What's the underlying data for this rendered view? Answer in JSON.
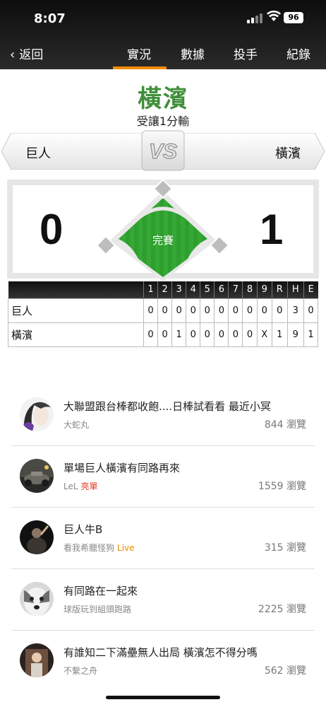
{
  "status_bar": {
    "time": "8:07",
    "battery": "96"
  },
  "nav": {
    "back_label": "返回",
    "tabs": [
      "實況",
      "數據",
      "投手",
      "紀錄"
    ],
    "active_tab": "實況"
  },
  "game": {
    "winner": "橫濱",
    "result_text": "受讓1分輸",
    "away_team": "巨人",
    "home_team": "橫濱",
    "vs_label": "VS",
    "away_score": "0",
    "home_score": "1",
    "status": "完賽"
  },
  "linescore": {
    "headers": [
      "1",
      "2",
      "3",
      "4",
      "5",
      "6",
      "7",
      "8",
      "9",
      "R",
      "H",
      "E"
    ],
    "rows": [
      {
        "team": "巨人",
        "cells": [
          "0",
          "0",
          "0",
          "0",
          "0",
          "0",
          "0",
          "0",
          "0",
          "0",
          "3",
          "0"
        ]
      },
      {
        "team": "橫濱",
        "cells": [
          "0",
          "0",
          "1",
          "0",
          "0",
          "0",
          "0",
          "0",
          "X",
          "1",
          "9",
          "1"
        ]
      }
    ]
  },
  "posts": [
    {
      "title": "大聯盟跟台棒都收飽....日棒試看看 最近小冥",
      "author": "大蛇丸",
      "tag": "",
      "views": "844 瀏覽",
      "avatar": "avatar-1"
    },
    {
      "title": "單場巨人橫濱有同路再來",
      "author": "LeL",
      "tag": "亮單",
      "views": "1559 瀏覽",
      "avatar": "avatar-2"
    },
    {
      "title": "巨人牛B",
      "author": "看我希臘怪狗",
      "tag": "Live",
      "views": "315 瀏覽",
      "avatar": "avatar-3"
    },
    {
      "title": "有同路在一起來",
      "author": "球版玩到組頭跑路",
      "tag": "",
      "views": "2225 瀏覽",
      "avatar": "avatar-4"
    },
    {
      "title": "有誰知二下滿壘無人出局 橫濱怎不得分嗎",
      "author": "不繫之舟",
      "tag": "",
      "views": "562 瀏覽",
      "avatar": "avatar-5"
    }
  ],
  "colors": {
    "accent": "#f08a00",
    "winner": "#3f8f3a",
    "field": "#2e9e2e",
    "live": "#f08a00",
    "hot": "#e03a1e"
  }
}
